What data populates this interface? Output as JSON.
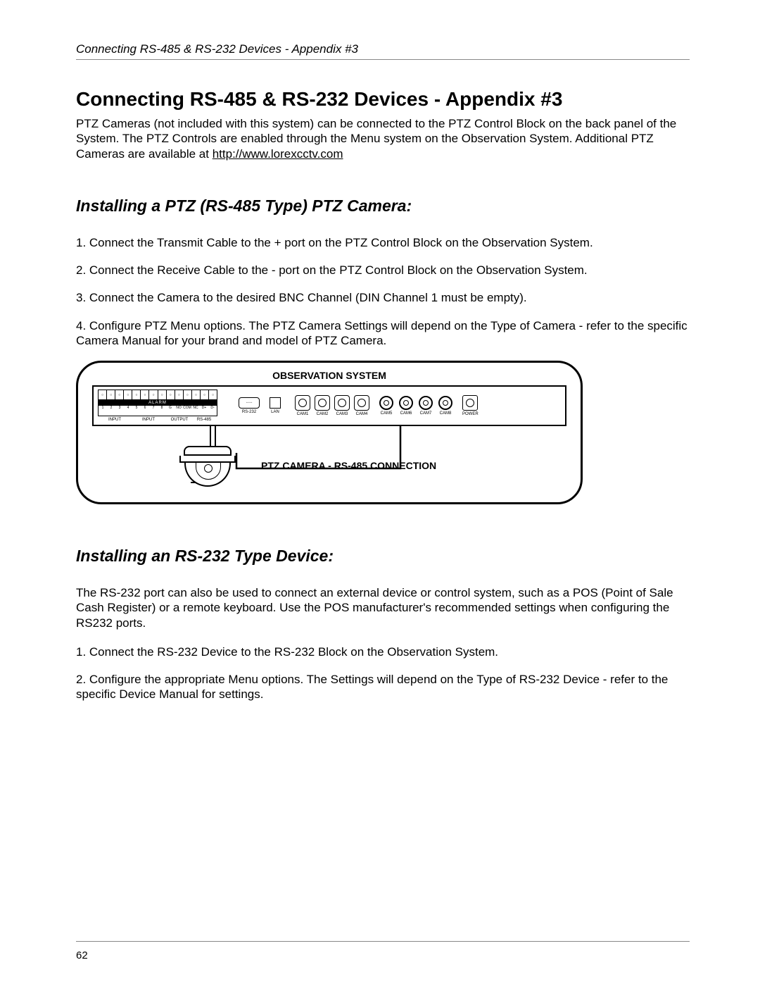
{
  "header": {
    "running_title": "Connecting RS-485 & RS-232 Devices - Appendix #3"
  },
  "title": "Connecting RS-485 & RS-232 Devices - Appendix #3",
  "intro": {
    "text_before_link": "PTZ Cameras (not included with this system) can be connected to the PTZ Control Block on the back panel of the System. The PTZ Controls are enabled through the Menu system on the Observation System. Additional PTZ Cameras are available at ",
    "link_text": "http://www.lorexcctv.com"
  },
  "section1": {
    "heading": "Installing a PTZ (RS-485 Type) PTZ Camera:",
    "steps": [
      "1. Connect the Transmit Cable to the + port on the PTZ Control Block on the Observation System.",
      "2. Connect the Receive Cable to the - port on the PTZ Control Block on the Observation System.",
      "3. Connect the Camera to the desired BNC Channel (DIN Channel 1 must be empty).",
      "4. Configure PTZ Menu options. The PTZ Camera Settings will depend on the Type of Camera - refer to the specific Camera Manual for your brand and model of PTZ Camera."
    ]
  },
  "diagram": {
    "top_label": "OBSERVATION SYSTEM",
    "bottom_label": "PTZ CAMERA - RS-485 CONNECTION",
    "ports": {
      "alarm_label": "ALARM",
      "terminal_numbers": [
        "1",
        "2",
        "3",
        "4",
        "5",
        "6",
        "7",
        "8",
        "G",
        "NO",
        "COM",
        "NC",
        "D+",
        "D-"
      ],
      "input_label_1": "INPUT",
      "input_label_2": "INPUT",
      "output_label": "OUTPUT",
      "rs485_label": "RS-485",
      "rs232_label": "RS-232",
      "lan_label": "LAN",
      "din_labels": [
        "CAM1",
        "CAM2",
        "CAM3",
        "CAM4"
      ],
      "bnc_labels": [
        "CAM5",
        "CAM6",
        "CAM7",
        "CAM8"
      ],
      "power_label": "POWER"
    }
  },
  "section2": {
    "heading": "Installing an RS-232 Type Device:",
    "intro": "The RS-232 port can also be used to connect an external device or control system, such as a POS (Point of Sale Cash Register) or a remote keyboard. Use the POS manufacturer's recommended settings when configuring the RS232 ports.",
    "steps": [
      "1. Connect the RS-232 Device to the RS-232 Block on the Observation System.",
      "2. Configure the appropriate Menu options. The Settings will depend on the Type of RS-232 Device - refer to the specific Device Manual for settings."
    ]
  },
  "page_number": "62"
}
